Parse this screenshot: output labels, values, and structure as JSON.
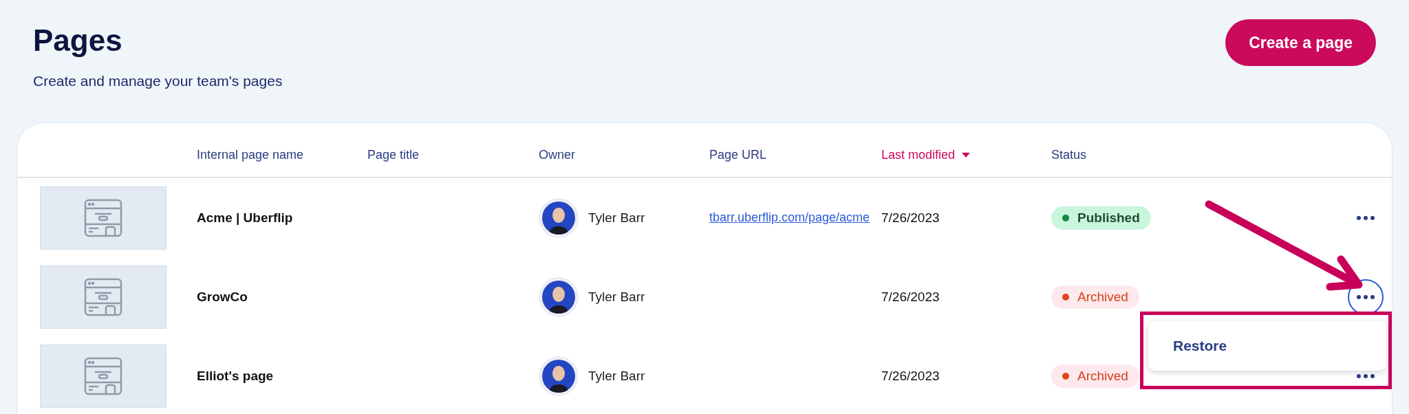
{
  "header": {
    "title": "Pages",
    "subtitle": "Create and manage your team's pages",
    "create_button": "Create a page"
  },
  "table": {
    "columns": [
      {
        "label": "Internal page name",
        "sorted": false
      },
      {
        "label": "Page title",
        "sorted": false
      },
      {
        "label": "Owner",
        "sorted": false
      },
      {
        "label": "Page URL",
        "sorted": false
      },
      {
        "label": "Last modified",
        "sorted": true
      },
      {
        "label": "Status",
        "sorted": false
      }
    ],
    "rows": [
      {
        "name": "Acme | Uberflip",
        "owner": "Tyler Barr",
        "url": "tbarr.uberflip.com/page/acme",
        "modified": "7/26/2023",
        "status": {
          "kind": "published",
          "label": "Published"
        },
        "menu_open": false
      },
      {
        "name": "GrowCo",
        "owner": "Tyler Barr",
        "modified": "7/26/2023",
        "status": {
          "kind": "archived",
          "label": "Archived"
        },
        "menu_open": true
      },
      {
        "name": "Elliot's page",
        "owner": "Tyler Barr",
        "modified": "7/26/2023",
        "status": {
          "kind": "archived",
          "label": "Archived"
        },
        "menu_open": false
      }
    ]
  },
  "row_menu": {
    "items": [
      "Restore"
    ]
  }
}
